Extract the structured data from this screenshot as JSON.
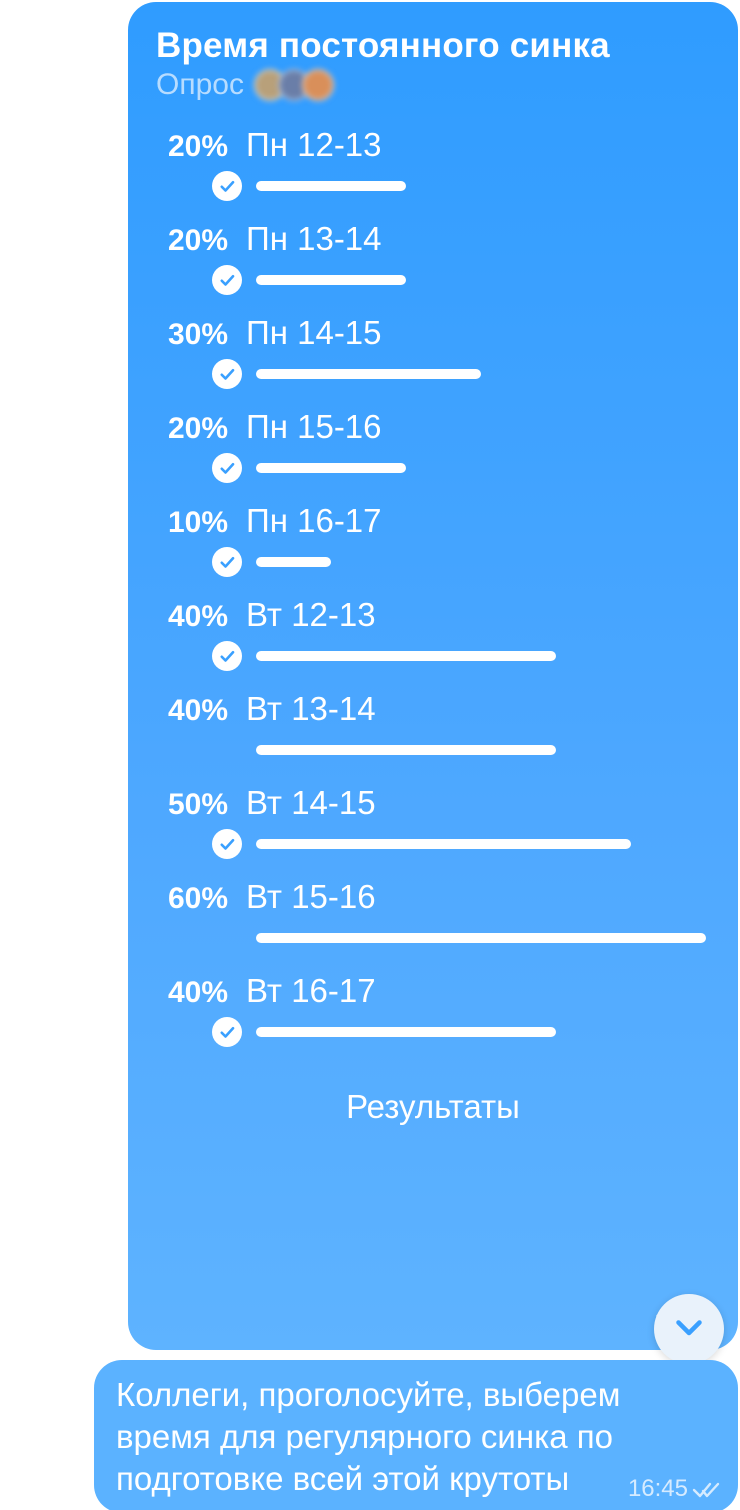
{
  "poll": {
    "title": "Время постоянного синка",
    "subtitle": "Опрос",
    "results_label": "Результаты",
    "time": "16:45",
    "options": [
      {
        "percent_label": "20%",
        "label": "Пн 12-13",
        "percent": 20,
        "voted": true
      },
      {
        "percent_label": "20%",
        "label": "Пн 13-14",
        "percent": 20,
        "voted": true
      },
      {
        "percent_label": "30%",
        "label": "Пн 14-15",
        "percent": 30,
        "voted": true
      },
      {
        "percent_label": "20%",
        "label": "Пн 15-16",
        "percent": 20,
        "voted": true
      },
      {
        "percent_label": "10%",
        "label": "Пн 16-17",
        "percent": 10,
        "voted": true
      },
      {
        "percent_label": "40%",
        "label": "Вт 12-13",
        "percent": 40,
        "voted": true
      },
      {
        "percent_label": "40%",
        "label": "Вт 13-14",
        "percent": 40,
        "voted": false
      },
      {
        "percent_label": "50%",
        "label": "Вт 14-15",
        "percent": 50,
        "voted": true
      },
      {
        "percent_label": "60%",
        "label": "Вт 15-16",
        "percent": 60,
        "voted": false
      },
      {
        "percent_label": "40%",
        "label": "Вт 16-17",
        "percent": 40,
        "voted": true
      }
    ]
  },
  "message": {
    "text": "Коллеги, проголосуйте, выберем время для регулярного синка по подготовке всей этой крутоты",
    "time": "16:45"
  },
  "chart_data": {
    "type": "bar",
    "title": "Время постоянного синка",
    "categories": [
      "Пн 12-13",
      "Пн 13-14",
      "Пн 14-15",
      "Пн 15-16",
      "Пн 16-17",
      "Вт 12-13",
      "Вт 13-14",
      "Вт 14-15",
      "Вт 15-16",
      "Вт 16-17"
    ],
    "values": [
      20,
      20,
      30,
      20,
      10,
      40,
      40,
      50,
      60,
      40
    ],
    "xlabel": "",
    "ylabel": "%",
    "ylim": [
      0,
      100
    ]
  },
  "colors": {
    "bubble_top": "#2f9cff",
    "bubble_bottom": "#5eb3ff",
    "fab_bg": "#e9f2fb",
    "fab_chevron": "#3aa0ff"
  }
}
